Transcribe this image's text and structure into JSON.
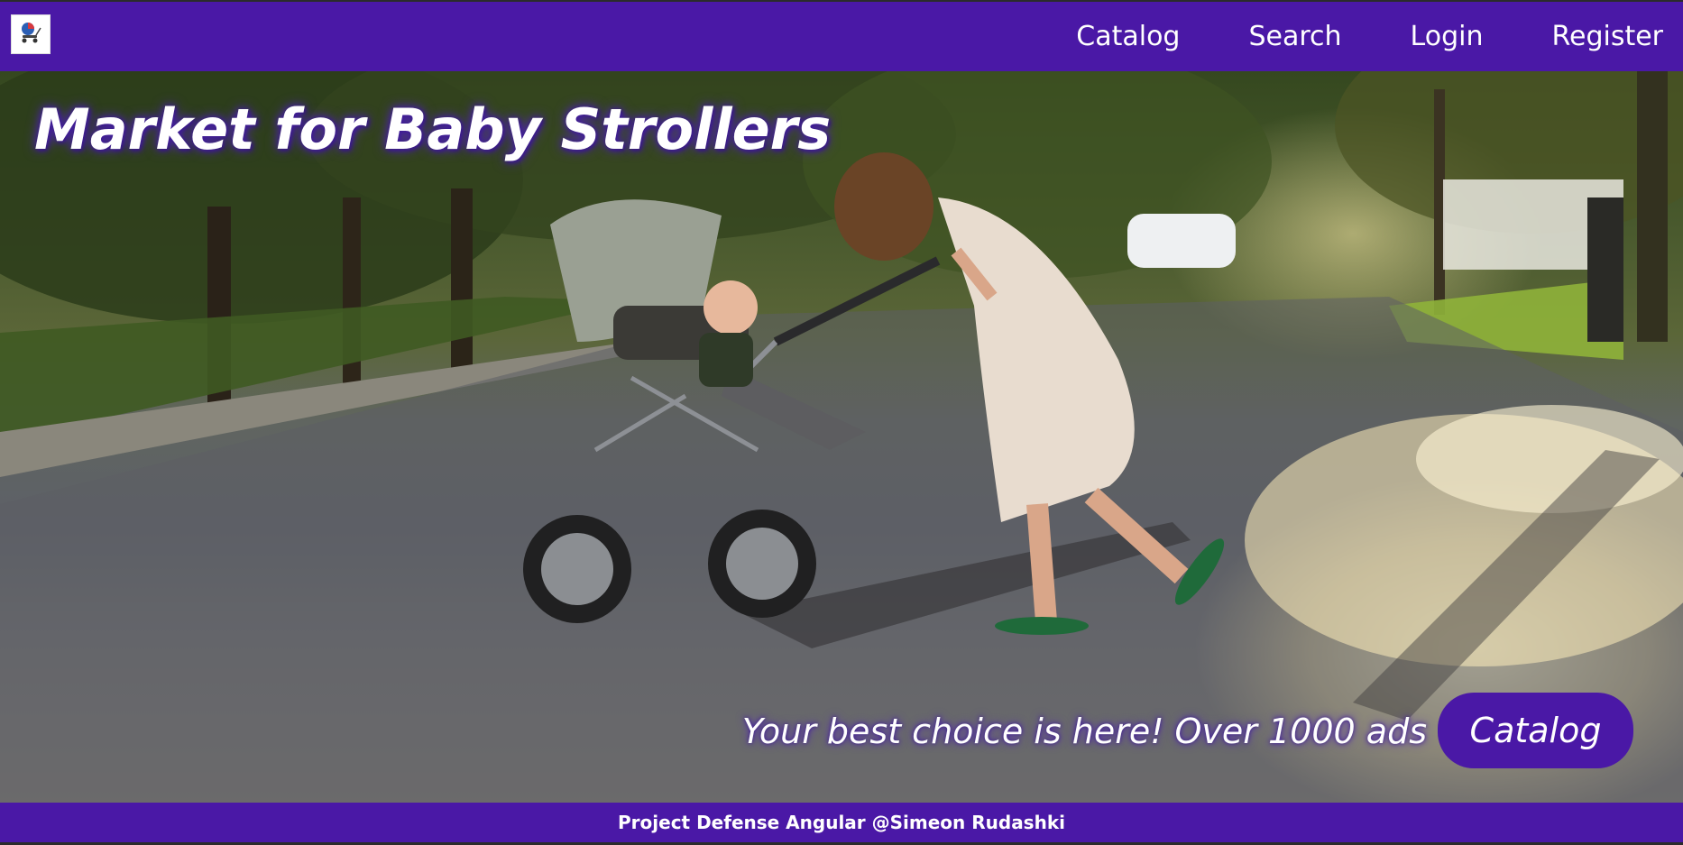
{
  "header": {
    "logo_icon": "stroller-logo-icon",
    "nav": [
      {
        "label": "Catalog"
      },
      {
        "label": "Search"
      },
      {
        "label": "Login"
      },
      {
        "label": "Register"
      }
    ]
  },
  "hero": {
    "title": "Market for Baby Strollers",
    "tagline": "Your best choice is here! Over 1000 ads",
    "cta_label": "Catalog",
    "image_subject": "mother pushing baby in stroller on sunlit street"
  },
  "footer": {
    "text": "Project Defense Angular @Simeon Rudashki"
  },
  "colors": {
    "brand": "#4a18a6",
    "text": "#ffffff"
  }
}
